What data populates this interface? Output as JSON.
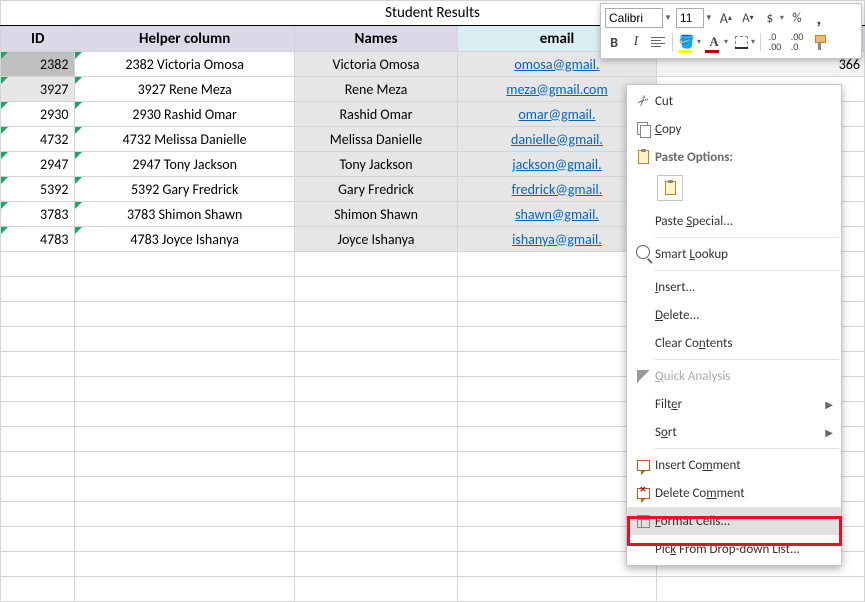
{
  "title": "Student Results",
  "headers": {
    "id": "ID",
    "helper": "Helper column",
    "names": "Names",
    "email": "email"
  },
  "extra_header": "366",
  "rows": [
    {
      "id": "2382",
      "helper": "2382 Victoria Omosa",
      "name": "Victoria Omosa",
      "email": "omosa@gmail."
    },
    {
      "id": "3927",
      "helper": "3927 Rene Meza",
      "name": "Rene Meza",
      "email": "meza@gmail.com"
    },
    {
      "id": "2930",
      "helper": "2930 Rashid Omar",
      "name": "Rashid Omar",
      "email": "omar@gmail."
    },
    {
      "id": "4732",
      "helper": "4732 Melissa Danielle",
      "name": "Melissa Danielle",
      "email": "danielle@gmail."
    },
    {
      "id": "2947",
      "helper": "2947 Tony Jackson",
      "name": "Tony Jackson",
      "email": "jackson@gmail."
    },
    {
      "id": "5392",
      "helper": "5392 Gary Fredrick",
      "name": "Gary Fredrick",
      "email": "fredrick@gmail."
    },
    {
      "id": "3783",
      "helper": "3783 Shimon Shawn",
      "name": "Shimon Shawn",
      "email": "shawn@gmail."
    },
    {
      "id": "4783",
      "helper": "4783 Joyce Ishanya",
      "name": "Joyce Ishanya",
      "email": "ishanya@gmail."
    }
  ],
  "toolbar": {
    "font": "Calibri",
    "size": "11"
  },
  "ctx": {
    "cut": "Cut",
    "copy": "Copy",
    "paste_options": "Paste Options:",
    "paste_special": "Paste Special...",
    "smart_lookup": "Smart Lookup",
    "insert": "Insert...",
    "delete": "Delete...",
    "clear": "Clear Contents",
    "quick": "Quick Analysis",
    "filter": "Filter",
    "sort": "Sort",
    "insert_comment": "Insert Comment",
    "delete_comment": "Delete Comment",
    "format_cells": "Format Cells...",
    "pick": "Pick From Drop-down List..."
  }
}
